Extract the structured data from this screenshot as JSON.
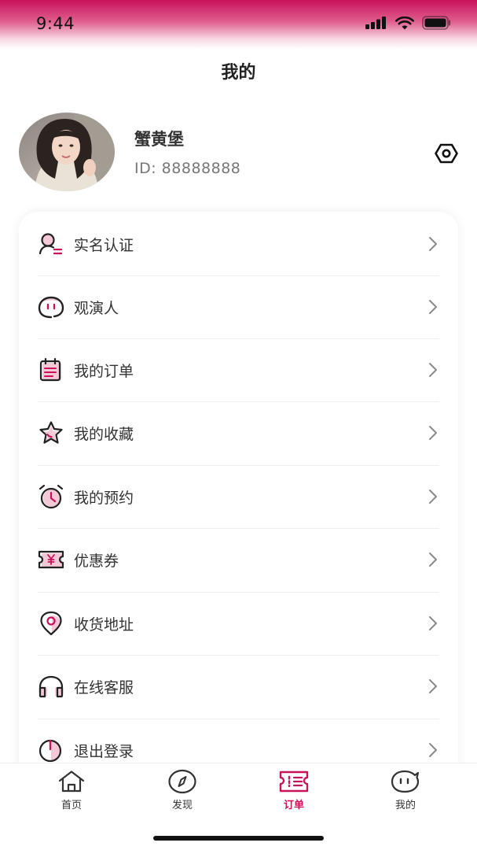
{
  "status_bar": {
    "time": "9:44"
  },
  "header": {
    "title": "我的"
  },
  "profile": {
    "name": "蟹黄堡",
    "id_text": "ID: 88888888"
  },
  "menu": {
    "items": [
      {
        "label": "实名认证",
        "icon": "id-verify-icon"
      },
      {
        "label": "观演人",
        "icon": "audience-face-icon"
      },
      {
        "label": "我的订单",
        "icon": "order-list-icon"
      },
      {
        "label": "我的收藏",
        "icon": "star-icon"
      },
      {
        "label": "我的预约",
        "icon": "alarm-clock-icon"
      },
      {
        "label": "优惠券",
        "icon": "coupon-icon"
      },
      {
        "label": "收货地址",
        "icon": "location-pin-icon"
      },
      {
        "label": "在线客服",
        "icon": "headset-icon"
      },
      {
        "label": "退出登录",
        "icon": "power-icon"
      }
    ]
  },
  "tab_bar": {
    "tabs": [
      {
        "label": "首页",
        "icon": "home-icon",
        "active": false
      },
      {
        "label": "发现",
        "icon": "compass-icon",
        "active": false
      },
      {
        "label": "订单",
        "icon": "order-ticket-icon",
        "active": true
      },
      {
        "label": "我的",
        "icon": "chat-face-icon",
        "active": false
      }
    ]
  },
  "colors": {
    "accent": "#c8125a",
    "accent_light": "#f3c9d8",
    "text": "#333333",
    "muted": "#777777"
  }
}
